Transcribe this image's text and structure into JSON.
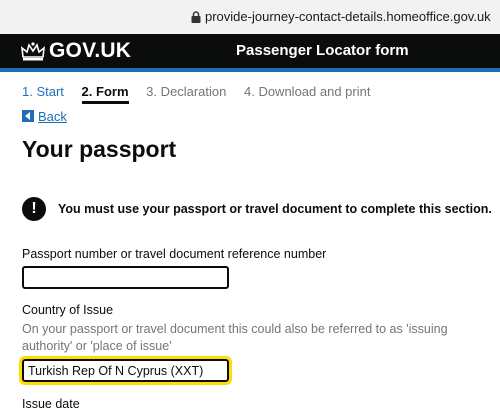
{
  "browser": {
    "url": "provide-journey-contact-details.homeoffice.gov.uk"
  },
  "header": {
    "logo": "GOV.UK",
    "service_name": "Passenger Locator form"
  },
  "steps": [
    {
      "label": "1. Start",
      "state": "link"
    },
    {
      "label": "2. Form",
      "state": "current"
    },
    {
      "label": "3. Declaration",
      "state": "future"
    },
    {
      "label": "4. Download and print",
      "state": "future"
    }
  ],
  "back_link": "Back",
  "page_title": "Your passport",
  "warning": {
    "icon": "!",
    "text": "You must use your passport or travel document to complete this section."
  },
  "fields": {
    "passport_number": {
      "label": "Passport number or travel document reference number",
      "value": ""
    },
    "country_of_issue": {
      "label": "Country of Issue",
      "hint": "On your passport or travel document this could also be referred to as 'issuing authority' or 'place of issue'",
      "value": "Turkish Rep Of N Cyprus (XXT)"
    },
    "issue_date": {
      "label": "Issue date"
    }
  },
  "colors": {
    "header": "#0b0c0c",
    "link": "#1d70b8",
    "focus": "#ffdd00",
    "hint": "#6f777b"
  }
}
